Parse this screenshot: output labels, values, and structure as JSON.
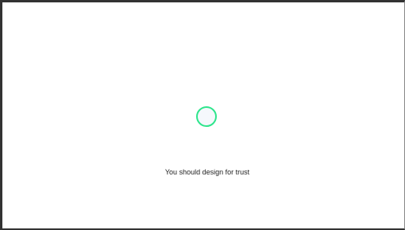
{
  "screen": {
    "loader": {
      "icon": "loading-circle-icon",
      "color": "#2ee58c"
    },
    "message": "You should design for trust"
  }
}
